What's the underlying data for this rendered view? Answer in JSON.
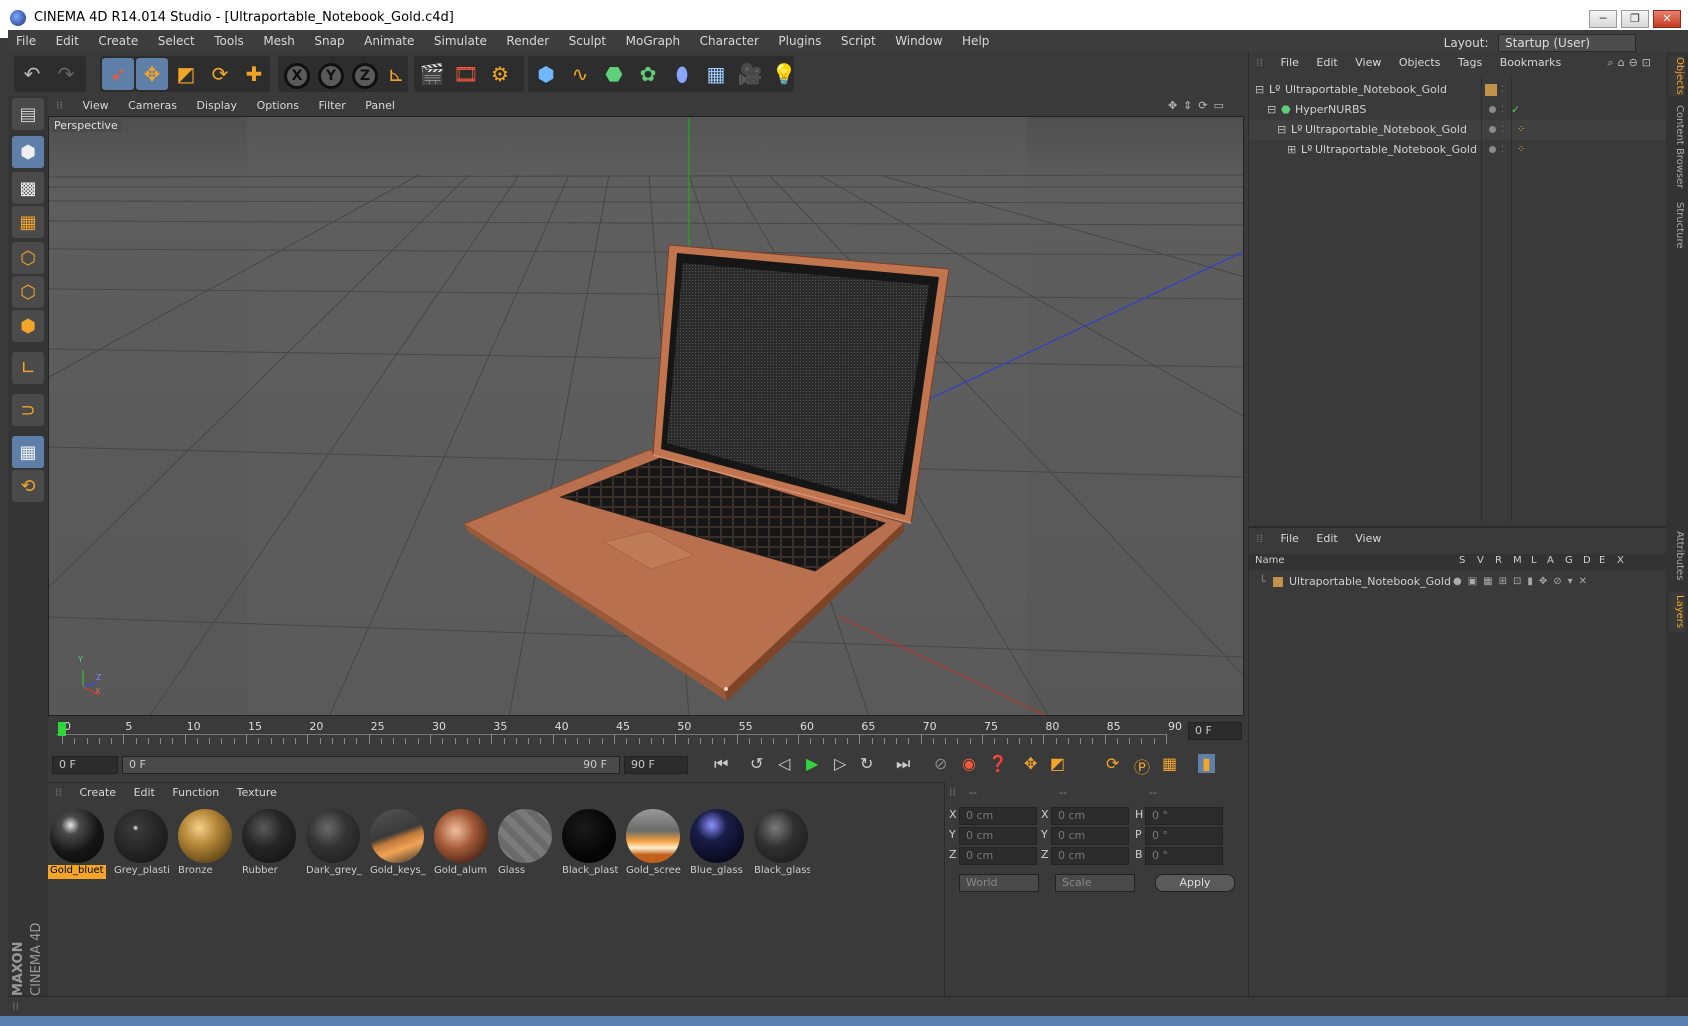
{
  "window": {
    "title": "CINEMA 4D R14.014 Studio - [Ultraportable_Notebook_Gold.c4d]"
  },
  "menu": [
    "File",
    "Edit",
    "Create",
    "Select",
    "Tools",
    "Mesh",
    "Snap",
    "Animate",
    "Simulate",
    "Render",
    "Sculpt",
    "MoGraph",
    "Character",
    "Plugins",
    "Script",
    "Window",
    "Help"
  ],
  "layout": {
    "label": "Layout:",
    "value": "Startup (User)"
  },
  "viewport": {
    "menu": [
      "View",
      "Cameras",
      "Display",
      "Options",
      "Filter",
      "Panel"
    ],
    "label": "Perspective",
    "axis_labels": {
      "x": "X",
      "y": "Y",
      "z": "Z"
    }
  },
  "toolbar_axes": [
    "X",
    "Y",
    "Z"
  ],
  "timeline": {
    "ticks": [
      "0",
      "5",
      "10",
      "15",
      "20",
      "25",
      "30",
      "35",
      "40",
      "45",
      "50",
      "55",
      "60",
      "65",
      "70",
      "75",
      "80",
      "85",
      "90"
    ],
    "current_frame": "0 F"
  },
  "transport": {
    "start": "0 F",
    "range_start": "0 F",
    "range_end": "90 F",
    "end": "90 F"
  },
  "materials": {
    "menu": [
      "Create",
      "Edit",
      "Function",
      "Texture"
    ],
    "items": [
      {
        "label": "Gold_bluet",
        "selected": true
      },
      {
        "label": "Grey_plasti"
      },
      {
        "label": "Bronze"
      },
      {
        "label": "Rubber"
      },
      {
        "label": "Dark_grey_"
      },
      {
        "label": "Gold_keys_"
      },
      {
        "label": "Gold_alum"
      },
      {
        "label": "Glass"
      },
      {
        "label": "Black_plast"
      },
      {
        "label": "Gold_scree"
      },
      {
        "label": "Blue_glass"
      },
      {
        "label": "Black_glass"
      }
    ]
  },
  "coords": {
    "headers": [
      "--",
      "--",
      "--"
    ],
    "rows": [
      {
        "a": "X",
        "av": "0 cm",
        "b": "X",
        "bv": "0 cm",
        "c": "H",
        "cv": "0 °"
      },
      {
        "a": "Y",
        "av": "0 cm",
        "b": "Y",
        "bv": "0 cm",
        "c": "P",
        "cv": "0 °"
      },
      {
        "a": "Z",
        "av": "0 cm",
        "b": "Z",
        "bv": "0 cm",
        "c": "B",
        "cv": "0 °"
      }
    ],
    "space": "World",
    "mode": "Scale",
    "apply": "Apply"
  },
  "objects": {
    "menu": [
      "File",
      "Edit",
      "View",
      "Objects",
      "Tags",
      "Bookmarks"
    ],
    "items": [
      {
        "label": "Ultraportable_Notebook_Gold"
      },
      {
        "label": "HyperNURBS"
      },
      {
        "label": "Ultraportable_Notebook_Gold"
      },
      {
        "label": "Ultraportable_Notebook_Gold"
      }
    ]
  },
  "layers": {
    "menu": [
      "File",
      "Edit",
      "View"
    ],
    "columns": [
      "Name",
      "S",
      "V",
      "R",
      "M",
      "L",
      "A",
      "G",
      "D",
      "E",
      "X"
    ],
    "items": [
      {
        "label": "Ultraportable_Notebook_Gold"
      }
    ]
  },
  "side_tabs": [
    "Objects",
    "Content Browser",
    "Structure",
    "Attributes",
    "Layers"
  ],
  "brand": {
    "maxon": "MAXON",
    "product": "CINEMA 4D"
  },
  "colors": {
    "accent": "#f3a527",
    "selection": "#5d7fa8",
    "laptop": "#c0754f"
  }
}
